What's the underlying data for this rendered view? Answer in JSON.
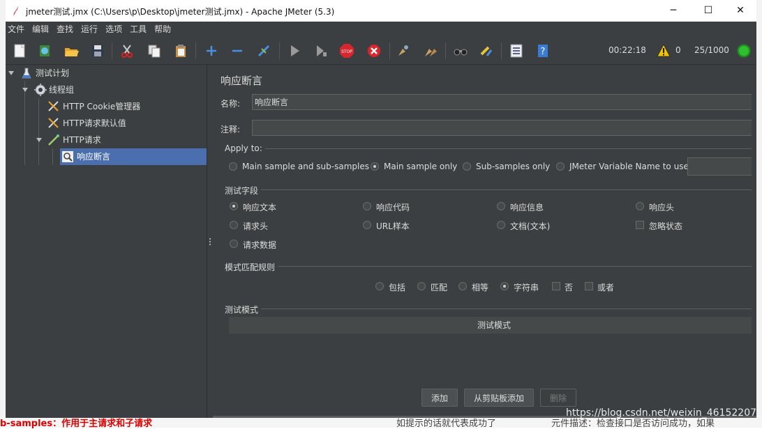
{
  "window": {
    "title": "jmeter测试.jmx (C:\\Users\\p\\Desktop\\jmeter测试.jmx) - Apache JMeter (5.3)",
    "minimize": "─",
    "maximize": "☐",
    "close": "✕"
  },
  "menu": [
    "文件",
    "编辑",
    "查找",
    "运行",
    "选项",
    "工具",
    "帮助"
  ],
  "toolbar": {
    "timer": "00:22:18",
    "warnings": "0",
    "threads": "25/1000",
    "icons": [
      "new-icon",
      "templates-icon",
      "open-icon",
      "save-icon",
      "cut-icon",
      "copy-icon",
      "paste-icon",
      "expand-icon",
      "collapse-icon",
      "toggle-icon",
      "start-icon",
      "start-no-pause-icon",
      "stop-icon",
      "shutdown-icon",
      "clear-icon",
      "clear-all-icon",
      "search-icon",
      "reset-search-icon",
      "function-helper-icon",
      "help-icon"
    ]
  },
  "tree": {
    "items": [
      {
        "label": "测试计划"
      },
      {
        "label": "线程组"
      },
      {
        "label": "HTTP Cookie管理器"
      },
      {
        "label": "HTTP请求默认值"
      },
      {
        "label": "HTTP请求"
      },
      {
        "label": "响应断言"
      }
    ]
  },
  "panel": {
    "title": "响应断言",
    "name_label": "名称:",
    "name_value": "响应断言",
    "comment_label": "注释:",
    "comment_value": "",
    "apply_to": {
      "title": "Apply to:",
      "options": [
        "Main sample and sub-samples",
        "Main sample only",
        "Sub-samples only",
        "JMeter Variable Name to use"
      ],
      "selected": "Main sample only",
      "variable_value": ""
    },
    "test_field": {
      "title": "测试字段",
      "options": [
        "响应文本",
        "响应代码",
        "响应信息",
        "响应头",
        "请求头",
        "URL样本",
        "文档(文本)",
        "忽略状态",
        "请求数据"
      ],
      "selected": "响应文本"
    },
    "pattern_rules": {
      "title": "模式匹配规则",
      "options": [
        "包括",
        "匹配",
        "相等",
        "字符串",
        "否",
        "或者"
      ],
      "selected": "字符串"
    },
    "patterns": {
      "title": "测试模式",
      "column_header": "测试模式"
    },
    "buttons": {
      "add": "添加",
      "add_clipboard": "从剪贴板添加",
      "delete": "删除"
    }
  },
  "background": {
    "left_bottom_text": "b-samples：作用于主请求和子请求",
    "bottom_mid_text": "如提示的话就代表成功了",
    "bottom_right_text": "元件描述：检查接口是否访问成功，如果"
  },
  "watermark": "https://blog.csdn.net/weixin_46152207",
  "colors": {
    "background": "#3c3f41",
    "selection": "#4b6eaf",
    "field": "#45494a",
    "text": "#dcdcdc"
  }
}
